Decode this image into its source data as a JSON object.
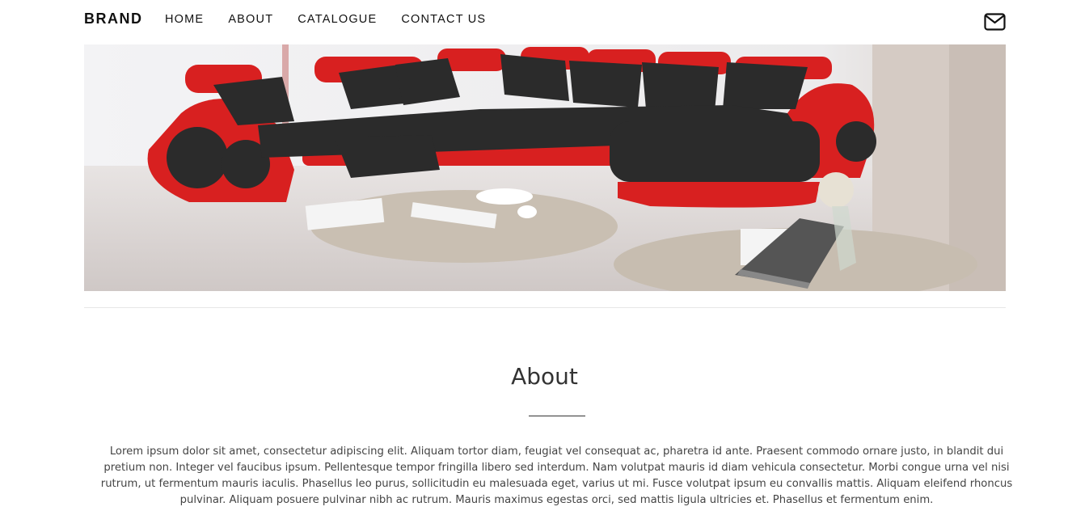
{
  "nav": {
    "brand": "BRAND",
    "links": [
      "HOME",
      "ABOUT",
      "CATALOGUE",
      "CONTACT US"
    ],
    "mail_icon": "envelope-icon"
  },
  "hero": {
    "subject": "red-and-black-sectional-sofa-photo"
  },
  "about": {
    "title": "About",
    "body": "Lorem ipsum dolor sit amet, consectetur adipiscing elit. Aliquam tortor diam, feugiat vel consequat ac, pharetra id ante. Praesent commodo ornare justo, in blandit dui pretium non. Integer vel faucibus ipsum. Pellentesque tempor fringilla libero sed interdum. Nam volutpat mauris id diam vehicula consectetur. Morbi congue urna vel nisi rutrum, ut fermentum mauris iaculis. Phasellus leo purus, sollicitudin eu malesuada eget, varius ut mi. Fusce volutpat ipsum eu convallis mattis. Aliquam eleifend rhoncus pulvinar. Aliquam posuere pulvinar nibh ac rutrum. Mauris maximus egestas orci, sed mattis ligula ultricies et. Phasellus et fermentum enim."
  },
  "colors": {
    "sofa_red": "#e01e1e",
    "sofa_black": "#2b2b2b",
    "floor": "#d9d4d2",
    "rug": "#c9bfb2",
    "text": "#333333"
  }
}
